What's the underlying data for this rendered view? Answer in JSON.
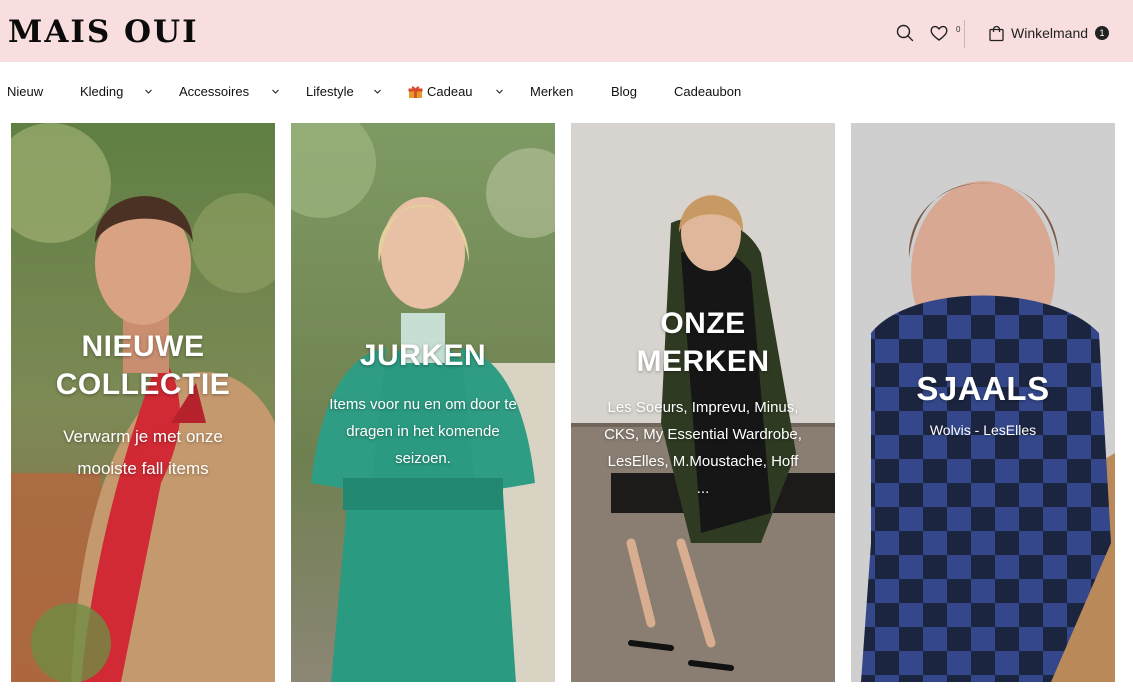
{
  "brand": {
    "logo": "MAIS OUI"
  },
  "header": {
    "wishlist_count": "0",
    "cart_label": "Winkelmand",
    "cart_count": "1",
    "icons": [
      "search-icon",
      "heart-icon",
      "shopping-bag-icon"
    ]
  },
  "nav": {
    "items": [
      {
        "label": "Nieuw",
        "has_dropdown": false
      },
      {
        "label": "Kleding",
        "has_dropdown": true
      },
      {
        "label": "Accessoires",
        "has_dropdown": true
      },
      {
        "label": "Lifestyle",
        "has_dropdown": true
      },
      {
        "label": "Cadeau",
        "has_dropdown": true,
        "icon": "gift-icon"
      },
      {
        "label": "Merken",
        "has_dropdown": false
      },
      {
        "label": "Blog",
        "has_dropdown": false
      },
      {
        "label": "Cadeaubon",
        "has_dropdown": false
      }
    ]
  },
  "tiles": [
    {
      "title_line1": "NIEUWE",
      "title_line2": "COLLECTIE",
      "subtitle_line1": "Verwarm je met onze",
      "subtitle_line2": "mooiste fall items"
    },
    {
      "title_line1": "JURKEN",
      "subtitle_line1": "Items voor nu en om door te",
      "subtitle_line2": "dragen in het komende",
      "subtitle_line3": "seizoen."
    },
    {
      "title_line1": "ONZE",
      "title_line2": "MERKEN",
      "subtitle_line1": "Les Soeurs, Imprevu, Minus,",
      "subtitle_line2": "CKS, My Essential Wardrobe,",
      "subtitle_line3": "LesElles, M.Moustache, Hoff",
      "subtitle_line4": "..."
    },
    {
      "title_line1": "SJAALS",
      "subtitle_line1": "Wolvis - LesElles"
    }
  ],
  "colors": {
    "header_bg": "#f8dede",
    "text": "#111111",
    "overlay_text": "#ffffff"
  }
}
